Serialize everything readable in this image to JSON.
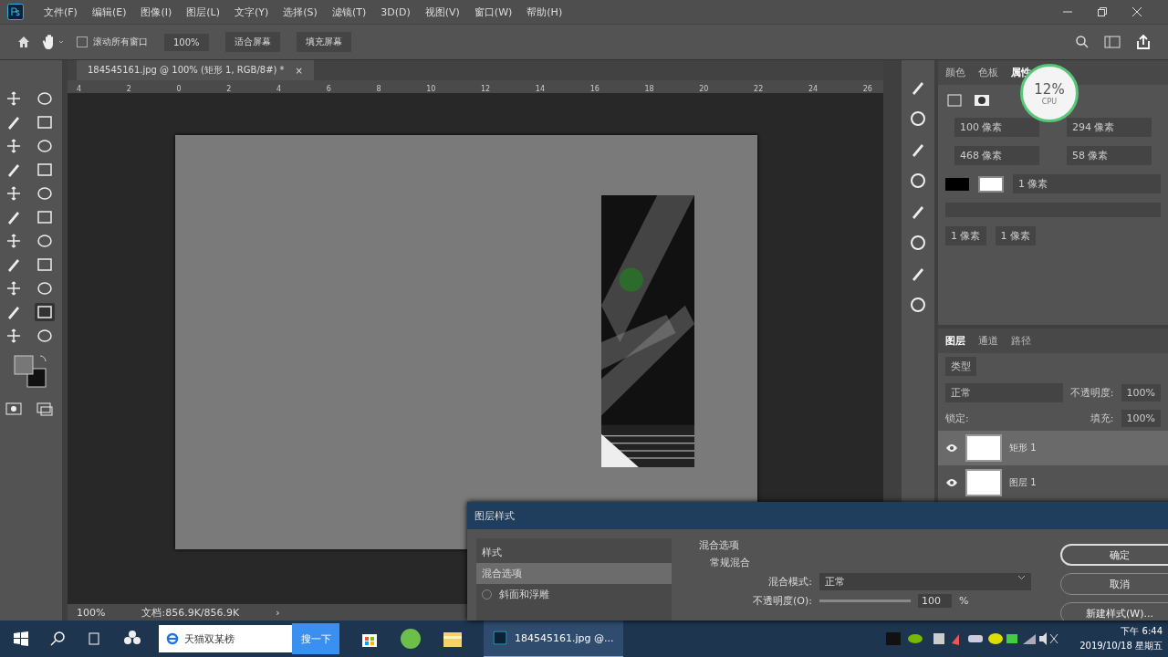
{
  "menu": [
    "文件(F)",
    "编辑(E)",
    "图像(I)",
    "图层(L)",
    "文字(Y)",
    "选择(S)",
    "滤镜(T)",
    "3D(D)",
    "视图(V)",
    "窗口(W)",
    "帮助(H)"
  ],
  "options_bar": {
    "scroll_all": {
      "label": "滚动所有窗口",
      "checked": false
    },
    "buttons": [
      "100%",
      "适合屏幕",
      "填充屏幕"
    ]
  },
  "document_tab": {
    "title": "184545161.jpg @ 100% (矩形 1, RGB/8#) *",
    "close": "×"
  },
  "ruler": [
    "4",
    "2",
    "0",
    "2",
    "4",
    "6",
    "8",
    "10",
    "12",
    "14",
    "16",
    "18",
    "20",
    "22",
    "24",
    "26"
  ],
  "status_bar": {
    "zoom": "100%",
    "doc": "文档:856.9K/856.9K",
    "arrow": "›"
  },
  "top_panel": {
    "tabs": [
      {
        "label": "颜色",
        "selected": false
      },
      {
        "label": "色板",
        "selected": false
      },
      {
        "label": "属性",
        "selected": true
      }
    ],
    "fields": [
      "100 像素",
      "294 像素",
      "468 像素",
      "58 像素"
    ],
    "stroke": "1 像素",
    "corners": [
      "1 像素",
      "1 像素"
    ]
  },
  "cpu_meter": {
    "value": "12%",
    "label": "CPU"
  },
  "layers_panel": {
    "tabs": [
      {
        "label": "图层",
        "selected": true
      },
      {
        "label": "通道",
        "selected": false
      },
      {
        "label": "路径",
        "selected": false
      }
    ],
    "filter": "类型",
    "blend": "正常",
    "opacity_label": "不透明度:",
    "opacity": "100%",
    "lock_label": "锁定:",
    "fill_label": "填充:",
    "fill": "100%",
    "layers": [
      {
        "name": "矩形 1",
        "selected": true,
        "visible": true
      },
      {
        "name": "图层 1",
        "selected": false,
        "visible": true
      }
    ]
  },
  "dialog": {
    "title": "图层样式",
    "sidebar": [
      {
        "label": "样式",
        "selected": false,
        "kind": "header"
      },
      {
        "label": "混合选项",
        "selected": true,
        "kind": "header"
      },
      {
        "label": "斜面和浮雕",
        "selected": false,
        "kind": "check"
      }
    ],
    "section": "混合选项",
    "subsection": "常规混合",
    "blend_label": "混合模式:",
    "blend": "正常",
    "opacity_label": "不透明度(O):",
    "opacity_slider": {
      "level": 1
    },
    "opacity": "100",
    "unit": "%",
    "buttons": [
      {
        "label": "确定",
        "selected": true
      },
      {
        "label": "取消",
        "selected": false
      },
      {
        "label": "新建样式(W)...",
        "selected": false
      }
    ]
  },
  "taskbar": {
    "search_text": "天猫双某榜",
    "search_button": "搜一下",
    "app": "184545161.jpg @...",
    "time": "下午 6:44",
    "date": "2019/10/18 星期五"
  }
}
